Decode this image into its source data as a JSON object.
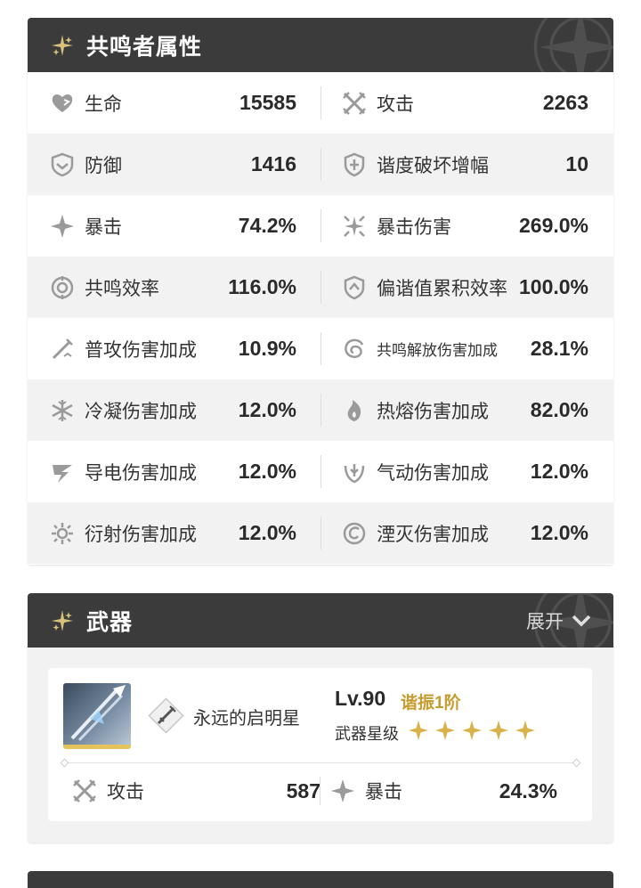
{
  "attributes": {
    "title": "共鸣者属性",
    "rows": [
      {
        "left": {
          "label": "生命",
          "value": "15585",
          "icon": "heart-icon"
        },
        "right": {
          "label": "攻击",
          "value": "2263",
          "icon": "crossed-swords-icon"
        }
      },
      {
        "left": {
          "label": "防御",
          "value": "1416",
          "icon": "shield-icon"
        },
        "right": {
          "label": "谐度破坏增幅",
          "value": "10",
          "icon": "shield-plus-icon"
        }
      },
      {
        "left": {
          "label": "暴击",
          "value": "74.2%",
          "icon": "crit-star-icon"
        },
        "right": {
          "label": "暴击伤害",
          "value": "269.0%",
          "icon": "crit-burst-icon"
        }
      },
      {
        "left": {
          "label": "共鸣效率",
          "value": "116.0%",
          "icon": "energy-ring-icon"
        },
        "right": {
          "label": "偏谐值累积效率",
          "value": "100.0%",
          "icon": "shield-up-icon"
        }
      },
      {
        "left": {
          "label": "普攻伤害加成",
          "value": "10.9%",
          "icon": "sword-slash-icon"
        },
        "right": {
          "label": "共鸣解放伤害加成",
          "value": "28.1%",
          "icon": "vortex-icon"
        }
      },
      {
        "left": {
          "label": "冷凝伤害加成",
          "value": "12.0%",
          "icon": "snowflake-icon"
        },
        "right": {
          "label": "热熔伤害加成",
          "value": "82.0%",
          "icon": "flame-icon"
        }
      },
      {
        "left": {
          "label": "导电伤害加成",
          "value": "12.0%",
          "icon": "lightning-icon"
        },
        "right": {
          "label": "气动伤害加成",
          "value": "12.0%",
          "icon": "wind-icon"
        }
      },
      {
        "left": {
          "label": "衍射伤害加成",
          "value": "12.0%",
          "icon": "sun-icon"
        },
        "right": {
          "label": "湮灭伤害加成",
          "value": "12.0%",
          "icon": "havoc-icon"
        }
      }
    ]
  },
  "weapon": {
    "title": "武器",
    "expand_label": "展开",
    "name": "永远的启明星",
    "level": "Lv.90",
    "refinement": "谐振1阶",
    "rarity_label": "武器星级",
    "stars": 5,
    "stats": [
      {
        "label": "攻击",
        "value": "587",
        "icon": "crossed-swords-icon"
      },
      {
        "label": "暴击",
        "value": "24.3%",
        "icon": "crit-star-icon"
      }
    ]
  },
  "colors": {
    "header_bg": "#3b3b3b",
    "accent_gold": "#c79b2d",
    "star_gold": "#d9b24a",
    "row_alt": "#f2f2f2"
  }
}
